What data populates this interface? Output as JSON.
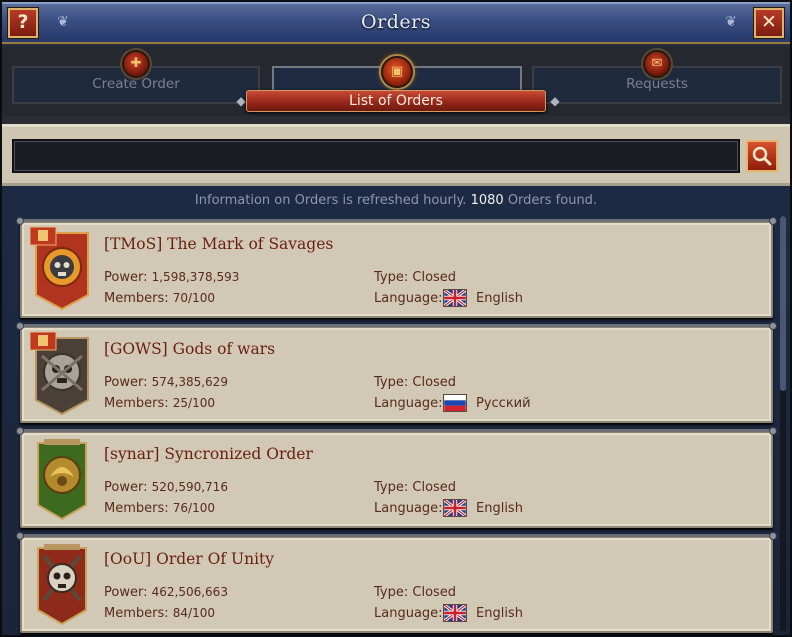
{
  "window": {
    "title": "Orders",
    "help_symbol": "?",
    "close_symbol": "✕"
  },
  "tabs": [
    {
      "label": "Create Order",
      "icon": "create-order-icon"
    },
    {
      "label": "",
      "icon": "list-of-orders-icon"
    },
    {
      "label": "Requests",
      "icon": "requests-icon"
    }
  ],
  "active_tab_ribbon": "List of Orders",
  "search": {
    "value": "",
    "placeholder": ""
  },
  "info": {
    "prefix": "Information on Orders is refreshed hourly.",
    "count": "1080",
    "suffix": "Orders found."
  },
  "labels": {
    "power": "Power:",
    "members": "Members:",
    "type": "Type:",
    "language": "Language:"
  },
  "orders": [
    {
      "name": "[TMoS] The Mark of Savages",
      "power": "1,598,378,593",
      "members": "70/100",
      "type": "Closed",
      "language": "English",
      "flag": "uk-flag",
      "has_ribbon": true,
      "crest": "skull-fire"
    },
    {
      "name": "[GOWS] Gods of wars",
      "power": "574,385,629",
      "members": "25/100",
      "type": "Closed",
      "language": "Русский",
      "flag": "russia-flag",
      "has_ribbon": true,
      "crest": "skull-grey"
    },
    {
      "name": "[synar] Syncronized Order",
      "power": "520,590,716",
      "members": "76/100",
      "type": "Closed",
      "language": "English",
      "flag": "uk-flag",
      "has_ribbon": false,
      "crest": "dragon-green"
    },
    {
      "name": "[OoU] Order Of Unity",
      "power": "462,506,663",
      "members": "84/100",
      "type": "Closed",
      "language": "English",
      "flag": "uk-flag",
      "has_ribbon": false,
      "crest": "skull-red"
    }
  ],
  "colors": {
    "title_bar": "#3a4f84",
    "accent_red": "#932517",
    "card_bg": "#d1c9b5",
    "name_text": "#6b1e10"
  }
}
